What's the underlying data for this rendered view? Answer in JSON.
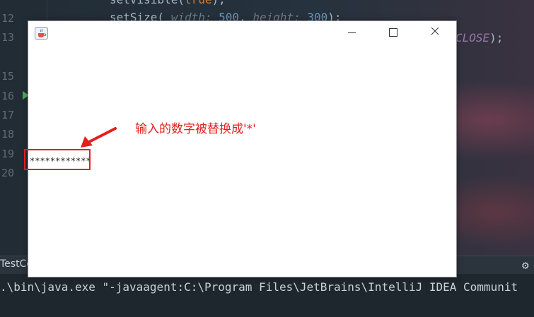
{
  "ide": {
    "line_numbers": [
      "12",
      "13",
      "15",
      "16",
      "17",
      "18",
      "19",
      "20"
    ],
    "code_line_1": {
      "method": "setVisible(",
      "kw": "true",
      "end": ");"
    },
    "code_line_2": {
      "method": "setSize( ",
      "hint_width": "width:",
      "width": "500",
      "comma": ", ",
      "hint_height": "height:",
      "height": "300",
      "end": ");"
    },
    "code_line_3": {
      "const": "CLOSE",
      "end": ");"
    },
    "console_tab": "TestCo",
    "console_output": ".\\bin\\java.exe \"-javaagent:C:\\Program Files\\JetBrains\\IntelliJ IDEA Communit"
  },
  "window": {
    "icon": "java-cup-icon",
    "controls": [
      "minimize-icon",
      "maximize-icon",
      "close-icon"
    ],
    "password_field_value": "************"
  },
  "annotation": {
    "text": "输入的数字被替换成'*'",
    "color": "#e0201f"
  }
}
